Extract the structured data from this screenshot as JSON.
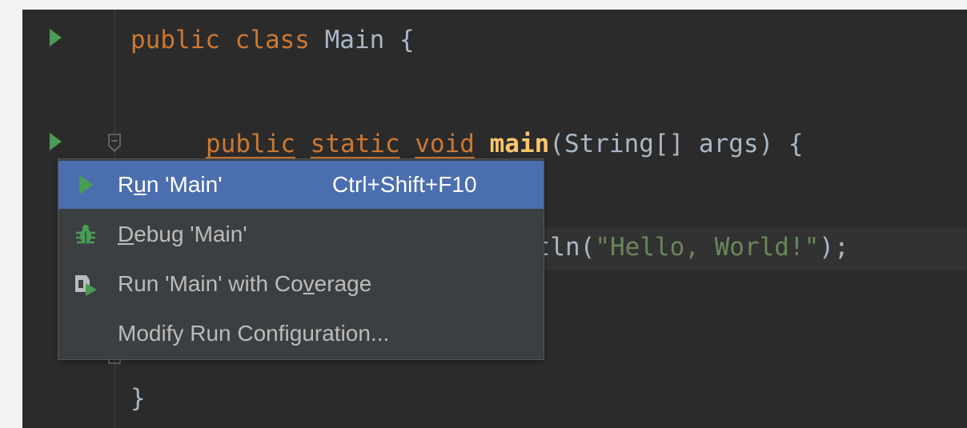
{
  "editor": {
    "lines": [
      {
        "tokens": [
          {
            "t": "public",
            "c": "kw"
          },
          {
            "t": " ",
            "c": ""
          },
          {
            "t": "class",
            "c": "kw"
          },
          {
            "t": " Main {",
            "c": ""
          }
        ]
      },
      {
        "tokens": [
          {
            "t": "public",
            "c": "kw-u"
          },
          {
            "t": " ",
            "c": ""
          },
          {
            "t": "static",
            "c": "kw-u"
          },
          {
            "t": " ",
            "c": ""
          },
          {
            "t": "void",
            "c": "kw-u"
          },
          {
            "t": " ",
            "c": ""
          },
          {
            "t": "main",
            "c": "fn"
          },
          {
            "t": "(String[] args) {",
            "c": ""
          }
        ]
      },
      {
        "tokens": [
          {
            "t": "ntln(",
            "c": ""
          },
          {
            "t": "\"Hello, World!\"",
            "c": "str"
          },
          {
            "t": ");",
            "c": ""
          }
        ]
      },
      {
        "tokens": [
          {
            "t": "}",
            "c": ""
          }
        ]
      }
    ]
  },
  "menu": {
    "items": [
      {
        "label_pre": "R",
        "label_u": "u",
        "label_post": "n 'Main'",
        "shortcut": "Ctrl+Shift+F10",
        "icon": "run-icon",
        "selected": true
      },
      {
        "label_pre": "",
        "label_u": "D",
        "label_post": "ebug 'Main'",
        "shortcut": "",
        "icon": "debug-icon",
        "selected": false
      },
      {
        "label_pre": "Run 'Main' with Co",
        "label_u": "v",
        "label_post": "erage",
        "shortcut": "",
        "icon": "coverage-icon",
        "selected": false
      },
      {
        "label_pre": "Modify Run Configuration...",
        "label_u": "",
        "label_post": "",
        "shortcut": "",
        "icon": "",
        "selected": false
      }
    ]
  },
  "colors": {
    "editor_bg": "#2b2b2b",
    "menu_bg": "#3c3f41",
    "selected_bg": "#4b6eaf",
    "run_green": "#499c54",
    "keyword": "#cc7832",
    "string": "#6a8759",
    "method": "#ffc66d"
  }
}
